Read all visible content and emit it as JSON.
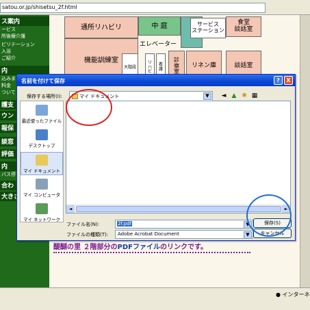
{
  "browser": {
    "url": "satou.or.jp/shisetsu_2f.html",
    "status_text": "インターネット"
  },
  "sidebar": {
    "items": [
      {
        "label": "ス案内",
        "header": true
      },
      {
        "label": "ービス",
        "header": false
      },
      {
        "label": "所後療介護",
        "header": false
      },
      {
        "label": "ビリテーション",
        "header": false
      },
      {
        "label": "入浴",
        "header": false
      },
      {
        "label": "ご紹介",
        "header": false
      },
      {
        "label": "内",
        "header": true
      },
      {
        "label": "込みま",
        "header": false
      },
      {
        "label": "料金",
        "header": false
      },
      {
        "label": "ついて",
        "header": false
      },
      {
        "label": "護支",
        "header": true
      },
      {
        "label": "ウン",
        "header": true
      },
      {
        "label": "報保",
        "header": true
      },
      {
        "label": "談窓",
        "header": true
      },
      {
        "label": "評価",
        "header": true
      },
      {
        "label": "内",
        "header": true
      },
      {
        "label": "バス停",
        "header": false
      },
      {
        "label": "合わ",
        "header": true
      },
      {
        "label": "大きさ",
        "header": true
      }
    ]
  },
  "floorplan": {
    "rooms": {
      "day_rehab": "通所リハビリ",
      "courtyard": "中 庭",
      "service_station": "サービス\nステーション",
      "dining": "食堂\n談話室",
      "training": "機能訓練室",
      "elevator": "エレベーター",
      "exam": "診\n察\n室",
      "linen": "リネン庫",
      "lounge": "談話室",
      "stair": "大階段",
      "small1": "リ\nハ\nビ",
      "small2": "看\n護"
    }
  },
  "bottom_note": {
    "prefix": "醍醐の里 ２階部分の",
    "link": "PDFファイル",
    "suffix": "のリンクです。"
  },
  "dialog": {
    "title": "名前を付けて保存",
    "help_symbol": "?",
    "close_symbol": "X",
    "location_label": "保存する場所(I):",
    "location_value": "マイ ドキュメント",
    "places": [
      {
        "label": "最近使ったファイル",
        "icon": "recent-files-icon"
      },
      {
        "label": "デスクトップ",
        "icon": "desktop-icon"
      },
      {
        "label": "マイ ドキュメント",
        "icon": "my-documents-icon",
        "selected": true
      },
      {
        "label": "マイ コンピュータ",
        "icon": "my-computer-icon"
      },
      {
        "label": "マイ ネットワーク",
        "icon": "my-network-icon"
      }
    ],
    "filename_label": "ファイル名(N):",
    "filename_value": "2f.pdf",
    "filetype_label": "ファイルの種類(T):",
    "filetype_value": "Adobe Acrobat Document",
    "save_button": "保存(S)",
    "cancel_button": "キャンセル"
  },
  "colors": {
    "title_bar": "#0a46d6",
    "annotation_red": "#e02020",
    "annotation_blue": "#1a6fcf",
    "sidebar_green": "#1f6b1b"
  }
}
